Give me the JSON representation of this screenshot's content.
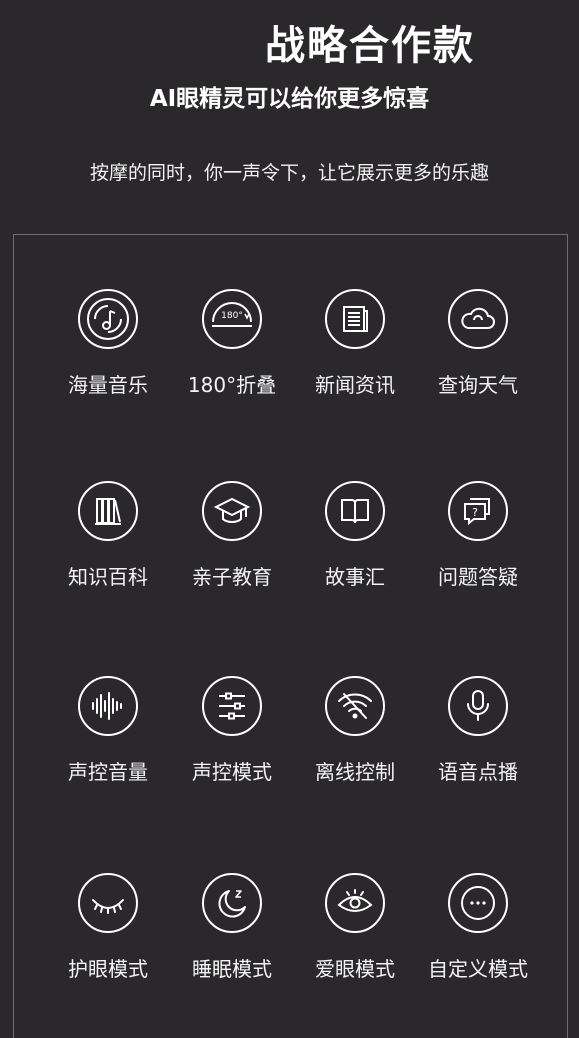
{
  "header": {
    "title": "战略合作款",
    "subtitle": "AI眼精灵可以给你更多惊喜",
    "description": "按摩的同时，你一声令下，让它展示更多的乐趣"
  },
  "features": [
    {
      "label": "海量音乐",
      "icon": "music-disc-icon"
    },
    {
      "label": "180°折叠",
      "icon": "fold-180-icon"
    },
    {
      "label": "新闻资讯",
      "icon": "news-icon"
    },
    {
      "label": "查询天气",
      "icon": "weather-cloud-icon"
    },
    {
      "label": "知识百科",
      "icon": "books-icon"
    },
    {
      "label": "亲子教育",
      "icon": "graduation-cap-icon"
    },
    {
      "label": "故事汇",
      "icon": "open-book-icon"
    },
    {
      "label": "问题答疑",
      "icon": "question-chat-icon"
    },
    {
      "label": "声控音量",
      "icon": "sound-wave-icon"
    },
    {
      "label": "声控模式",
      "icon": "sliders-icon"
    },
    {
      "label": "离线控制",
      "icon": "wifi-off-icon"
    },
    {
      "label": "语音点播",
      "icon": "microphone-icon"
    },
    {
      "label": "护眼模式",
      "icon": "closed-eye-icon"
    },
    {
      "label": "睡眠模式",
      "icon": "moon-sleep-icon"
    },
    {
      "label": "爱眼模式",
      "icon": "open-eye-icon"
    },
    {
      "label": "自定义模式",
      "icon": "more-dots-icon"
    }
  ],
  "colors": {
    "background": "#2a282b",
    "text": "#ffffff",
    "border": "#6e6c70"
  }
}
